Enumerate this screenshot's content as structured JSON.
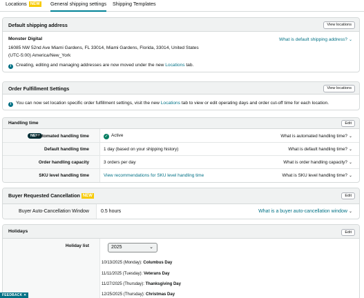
{
  "tabs": [
    {
      "label": "Locations",
      "badge": "NEW"
    },
    {
      "label": "General shipping settings"
    },
    {
      "label": "Shipping Templates"
    }
  ],
  "default_address": {
    "title": "Default shipping address",
    "button": "View locations",
    "name": "Monster Digital",
    "address": "16085 NW 52nd Ave Miami Gardens, FL 33014, Miami Gardens, Florida, 33014, United States",
    "timezone": "(UTC-5:00) America/New_York",
    "help_link": "What is default shipping address?",
    "notice_pre": "Creating, editing and managing addresses are now moved under the new ",
    "notice_link": "Locations",
    "notice_post": " tab."
  },
  "order_fulfillment": {
    "title": "Order Fulfillment Settings",
    "button": "View locations",
    "notice_pre": "You can now set location specific order fulfillment settings, visit the new ",
    "notice_link": "Locations",
    "notice_post": " tab to view or edit operating days and order cut-off time for each location."
  },
  "handling_time": {
    "title": "Handling time",
    "edit": "Edit",
    "new_badge": "NEW",
    "rows": [
      {
        "label": "Automated handling time",
        "value": "Active",
        "help": "What is automated handling time?"
      },
      {
        "label": "Default handling time",
        "value": "1 day (based on your shipping history)",
        "help": "What is default handling time?"
      },
      {
        "label": "Order handling capacity",
        "value": "3 orders per day",
        "help": "What is order handling capacity?"
      },
      {
        "label": "SKU level handling time",
        "value": "View recommendations for SKU level handling time",
        "help": "What is SKU level handling time?"
      }
    ]
  },
  "cancellation": {
    "title": "Buyer Requested Cancellation",
    "badge": "NEW",
    "edit": "Edit",
    "label": "Buyer Auto-Cancellation Window",
    "value": "0.5 hours",
    "help": "What is a buyer auto-cancellation window"
  },
  "holidays": {
    "title": "Holidays",
    "edit": "Edit",
    "list_label": "Holiday list",
    "year": "2025",
    "items": [
      {
        "date": "10/13/2025 (Monday):",
        "name": "Columbus Day"
      },
      {
        "date": "11/11/2025 (Tuesday):",
        "name": "Veterans Day"
      },
      {
        "date": "11/27/2025 (Thursday):",
        "name": "Thanksgiving Day"
      },
      {
        "date": "12/25/2025 (Thursday):",
        "name": "Christmas Day"
      }
    ]
  },
  "feedback": "FEEDBACK ✕",
  "colors": {
    "accent": "#007185",
    "new_badge": "#f7ca00",
    "dark_badge": "#002f36",
    "success": "#067d62"
  }
}
